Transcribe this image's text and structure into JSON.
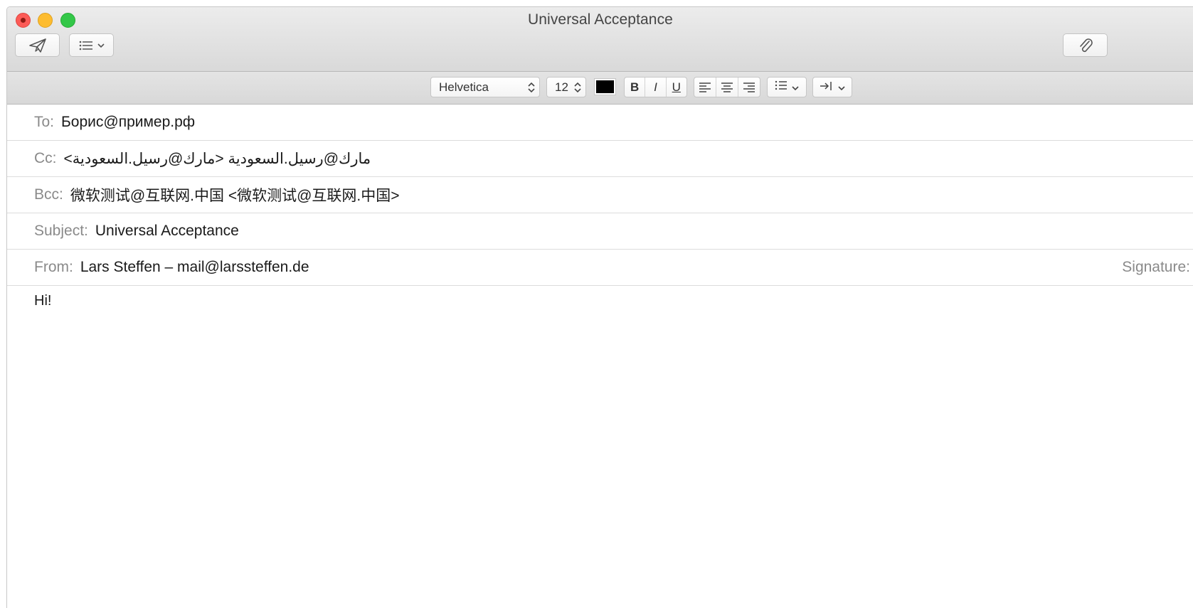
{
  "window": {
    "title": "Universal Acceptance"
  },
  "toolbar": {
    "send_icon": "paper-plane-icon",
    "header_fields_icon": "list-icon",
    "attach_icon": "paperclip-icon"
  },
  "format_bar": {
    "font_family": "Helvetica",
    "font_size": "12",
    "text_color": "#000000",
    "bold": "B",
    "italic": "I",
    "underline": "U"
  },
  "headers": {
    "to_label": "To:",
    "to_value": "Борис@пример.рф",
    "cc_label": "Cc:",
    "cc_value": "مارك@رسيل.السعودية <مارك@رسيل.السعودية>",
    "bcc_label": "Bcc:",
    "bcc_value": "微软测试@互联网.中国 <微软测试@互联网.中国>",
    "subject_label": "Subject:",
    "subject_value": "Universal Acceptance",
    "from_label": "From:",
    "from_value": "Lars Steffen – mail@larssteffen.de",
    "signature_label": "Signature:"
  },
  "body": {
    "text": "Hi!"
  }
}
